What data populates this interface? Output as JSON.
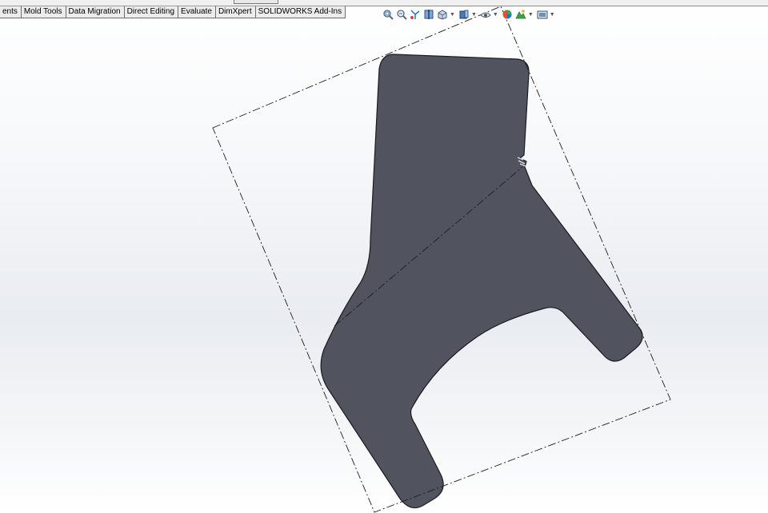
{
  "command_manager": {
    "tabs": [
      {
        "label": "ents"
      },
      {
        "label": "Mold Tools"
      },
      {
        "label": "Data Migration"
      },
      {
        "label": "Direct Editing"
      },
      {
        "label": "Evaluate"
      },
      {
        "label": "DimXpert"
      },
      {
        "label": "SOLIDWORKS Add-Ins"
      }
    ]
  },
  "heads_up_toolbar": {
    "icons": [
      "zoom-to-fit-icon",
      "zoom-to-area-icon",
      "previous-view-icon",
      "section-view-icon",
      "view-orientation-icon",
      "display-style-icon",
      "hide-show-items-icon",
      "edit-appearance-icon",
      "apply-scene-icon",
      "view-settings-icon"
    ]
  },
  "colors": {
    "part_fill": "#51535f",
    "part_edge": "#1b1b22",
    "sketch_line": "#1e1e1e",
    "accent_blue": "#2a6fc9"
  },
  "model": {
    "part_shape": "flat-plate-part",
    "sketch_style": "dash-dot"
  }
}
